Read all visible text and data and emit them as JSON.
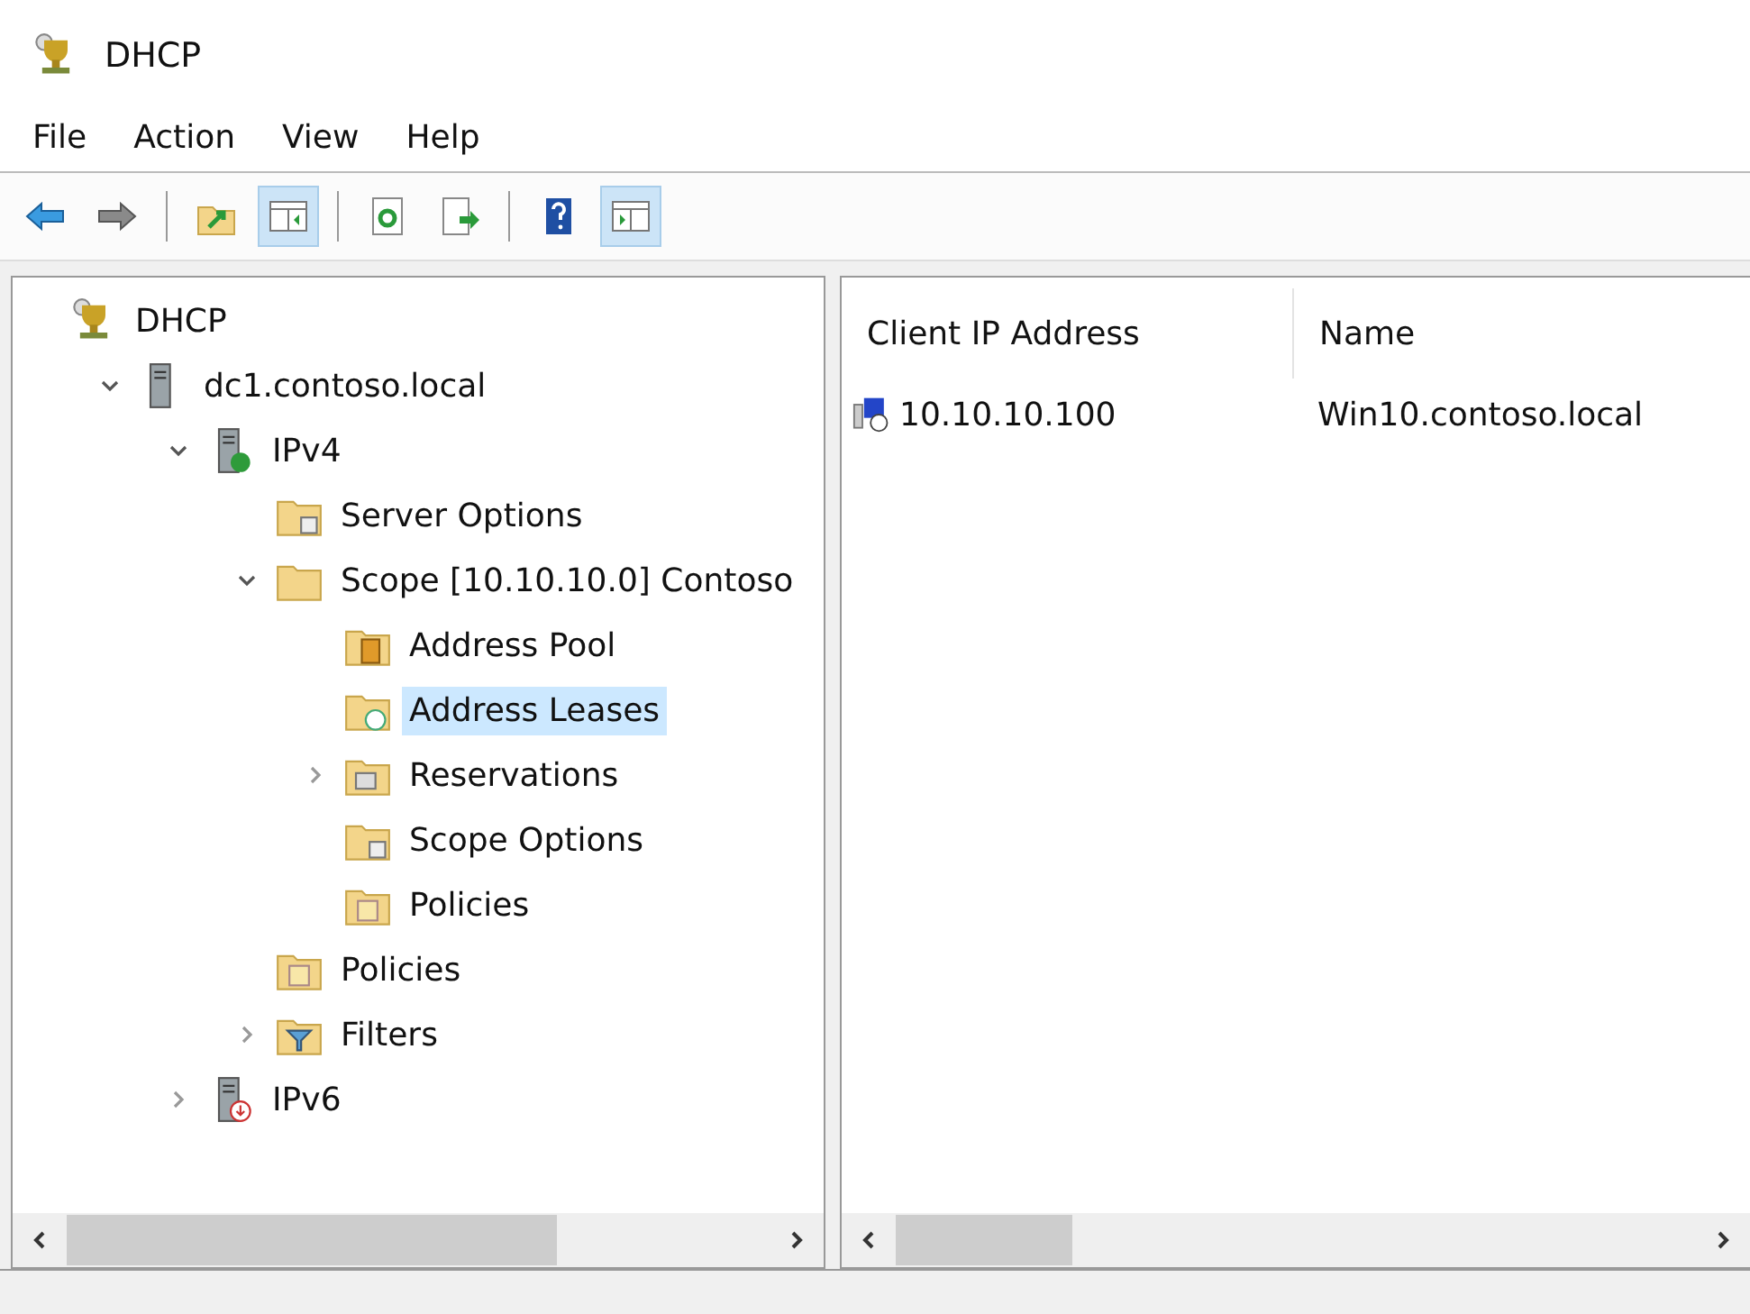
{
  "window": {
    "title": "DHCP"
  },
  "menu": [
    "File",
    "Action",
    "View",
    "Help"
  ],
  "toolbar": [
    {
      "kind": "back",
      "selected": false
    },
    {
      "kind": "forward",
      "selected": false
    },
    {
      "kind": "separator"
    },
    {
      "kind": "up",
      "selected": false
    },
    {
      "kind": "show-tree",
      "selected": true
    },
    {
      "kind": "separator"
    },
    {
      "kind": "refresh",
      "selected": false
    },
    {
      "kind": "export",
      "selected": false
    },
    {
      "kind": "separator"
    },
    {
      "kind": "help",
      "selected": false
    },
    {
      "kind": "show-action",
      "selected": true
    }
  ],
  "tree": [
    {
      "label": "DHCP",
      "kind": "dhcp",
      "selected": false,
      "children": [
        {
          "label": "dc1.contoso.local",
          "kind": "server",
          "selected": false,
          "expanded": true,
          "children": [
            {
              "label": "IPv4",
              "kind": "ipv4",
              "selected": false,
              "expanded": true,
              "children": [
                {
                  "label": "Server Options",
                  "kind": "options",
                  "selected": false
                },
                {
                  "label": "Scope [10.10.10.0] Contoso",
                  "kind": "folder",
                  "selected": false,
                  "expanded": true,
                  "children": [
                    {
                      "label": "Address Pool",
                      "kind": "pool",
                      "selected": false
                    },
                    {
                      "label": "Address Leases",
                      "kind": "leases",
                      "selected": true
                    },
                    {
                      "label": "Reservations",
                      "kind": "reservations",
                      "selected": false,
                      "expanded": false
                    },
                    {
                      "label": "Scope Options",
                      "kind": "options",
                      "selected": false
                    },
                    {
                      "label": "Policies",
                      "kind": "policies",
                      "selected": false
                    }
                  ]
                },
                {
                  "label": "Policies",
                  "kind": "policies",
                  "selected": false
                },
                {
                  "label": "Filters",
                  "kind": "filters",
                  "selected": false,
                  "expanded": false
                }
              ]
            },
            {
              "label": "IPv6",
              "kind": "ipv6",
              "selected": false,
              "expanded": false
            }
          ]
        }
      ]
    }
  ],
  "table": {
    "columns": [
      "Client IP Address",
      "Name"
    ],
    "rows": [
      {
        "cells": [
          "10.10.10.100",
          "Win10.contoso.local"
        ]
      }
    ]
  }
}
